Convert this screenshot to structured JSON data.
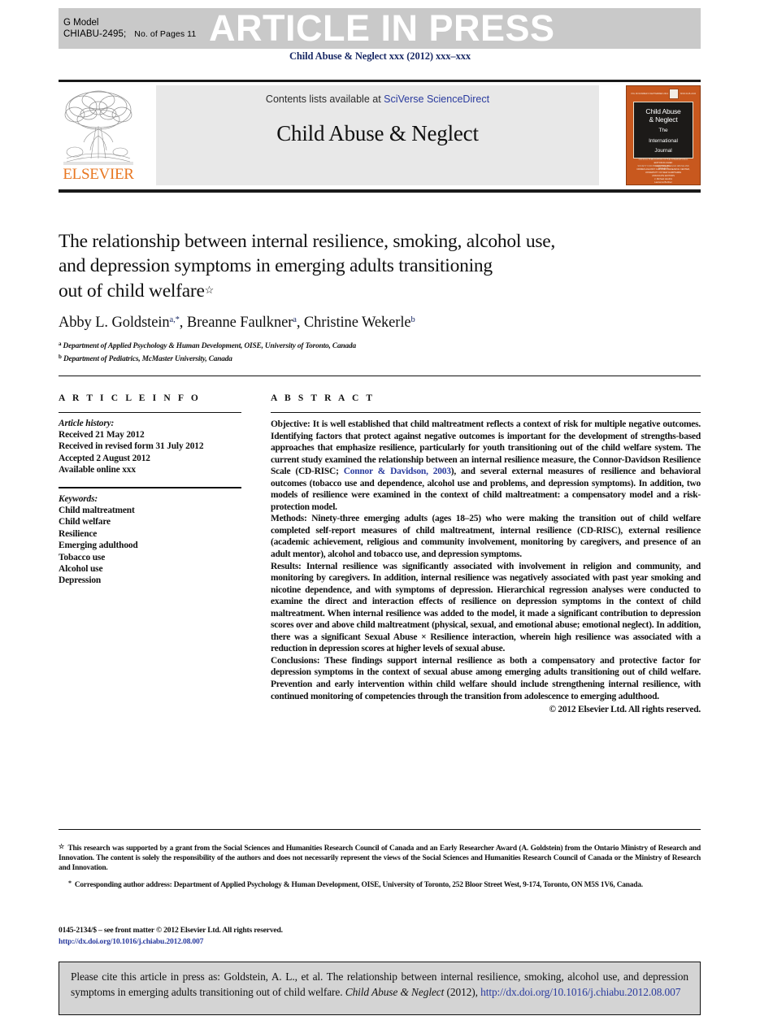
{
  "banner": {
    "gmodel_label": "G Model",
    "article_id": "CHIABU-2495;",
    "pages_label": "No. of Pages 11",
    "press_text": "ARTICLE IN PRESS",
    "banner_bg": "#c9c9c9",
    "press_color": "#ffffff"
  },
  "journal_citation": "Child Abuse & Neglect xxx (2012) xxx–xxx",
  "masthead": {
    "publisher_name": "ELSEVIER",
    "publisher_color": "#e87722",
    "contents_prefix": "Contents lists available at ",
    "contents_link": "SciVerse ScienceDirect",
    "link_color": "#2a3b9e",
    "journal_name": "Child Abuse & Neglect",
    "cover": {
      "top_left": "VOL 36 NUMBER 9 SEPTEMBER 2012",
      "top_right": "ISSN 0145-2134",
      "title_line1": "Child Abuse",
      "title_line2": "& Neglect",
      "subtitle_line1": "The",
      "subtitle_line2": "International",
      "subtitle_line3": "Journal",
      "tiny_line1": "OFFICIAL PUBLICATION OF THE INTERNATIONAL",
      "tiny_line2": "SOCIETY FOR PREVENTION OF CHILD ABUSE AND NEGLECT",
      "footer_line1": "EDITOR-IN-CHIEF",
      "footer_line2": "David Finkelhor",
      "footer_line3": "CRIMES AGAINST CHILDREN RESEARCH CENTER, UNIVERSITY OF NEW HAMPSHIRE",
      "footer_line4": "ASSOCIATE EDITORS",
      "footer_line5": "J. Michael Hendrix",
      "footer_line6": "Lawrence Berliner",
      "bg_color": "#c8581e"
    }
  },
  "article": {
    "title_line1": "The relationship between internal resilience, smoking, alcohol use,",
    "title_line2": "and depression symptoms in emerging adults transitioning",
    "title_line3": "out of child welfare",
    "title_footnote_mark": "☆",
    "authors": [
      {
        "name": "Abby L. Goldstein",
        "marks": "a,*"
      },
      {
        "name": "Breanne Faulkner",
        "marks": "a"
      },
      {
        "name": "Christine Wekerle",
        "marks": "b"
      }
    ],
    "affiliations": [
      {
        "mark": "a",
        "text": "Department of Applied Psychology & Human Development, OISE, University of Toronto, Canada"
      },
      {
        "mark": "b",
        "text": "Department of Pediatrics, McMaster University, Canada"
      }
    ]
  },
  "article_info": {
    "heading": "A R T I C L E   I N F O",
    "history_label": "Article history:",
    "history": [
      "Received 21 May 2012",
      "Received in revised form 31 July 2012",
      "Accepted 2 August 2012",
      "Available online xxx"
    ],
    "keywords_label": "Keywords:",
    "keywords": [
      "Child maltreatment",
      "Child welfare",
      "Resilience",
      "Emerging adulthood",
      "Tobacco use",
      "Alcohol use",
      "Depression"
    ]
  },
  "abstract": {
    "heading": "A B S T R A C T",
    "objective_label": "Objective:",
    "objective_part1": " It is well established that child maltreatment reflects a context of risk for multiple negative outcomes. Identifying factors that protect against negative outcomes is important for the development of strengths-based approaches that emphasize resilience, particularly for youth transitioning out of the child welfare system. The current study examined the relationship between an internal resilience measure, the Connor-Davidson Resilience Scale (CD-RISC; ",
    "objective_citation": "Connor & Davidson, 2003",
    "objective_part2": "), and several external measures of resilience and behavioral outcomes (tobacco use and dependence, alcohol use and problems, and depression symptoms). In addition, two models of resilience were examined in the context of child maltreatment: a compensatory model and a risk-protection model.",
    "methods_label": "Methods:",
    "methods_text": " Ninety-three emerging adults (ages 18–25) who were making the transition out of child welfare completed self-report measures of child maltreatment, internal resilience (CD-RISC), external resilience (academic achievement, religious and community involvement, monitoring by caregivers, and presence of an adult mentor), alcohol and tobacco use, and depression symptoms.",
    "results_label": "Results:",
    "results_text": " Internal resilience was significantly associated with involvement in religion and community, and monitoring by caregivers. In addition, internal resilience was negatively associated with past year smoking and nicotine dependence, and with symptoms of depression. Hierarchical regression analyses were conducted to examine the direct and interaction effects of resilience on depression symptoms in the context of child maltreatment. When internal resilience was added to the model, it made a significant contribution to depression scores over and above child maltreatment (physical, sexual, and emotional abuse; emotional neglect). In addition, there was a significant Sexual Abuse × Resilience interaction, wherein high resilience was associated with a reduction in depression scores at higher levels of sexual abuse.",
    "conclusions_label": "Conclusions:",
    "conclusions_text": " These findings support internal resilience as both a compensatory and protective factor for depression symptoms in the context of sexual abuse among emerging adults transitioning out of child welfare. Prevention and early intervention within child welfare should include strengthening internal resilience, with continued monitoring of competencies through the transition from adolescence to emerging adulthood.",
    "copyright": "© 2012 Elsevier Ltd. All rights reserved."
  },
  "footnotes": {
    "funding_mark": "☆",
    "funding_text": "This research was supported by a grant from the Social Sciences and Humanities Research Council of Canada and an Early Researcher Award (A. Goldstein) from the Ontario Ministry of Research and Innovation. The content is solely the responsibility of the authors and does not necessarily represent the views of the Social Sciences and Humanities Research Council of Canada or the Ministry of Research and Innovation.",
    "corresponding_mark": "*",
    "corresponding_text": "Corresponding author address: Department of Applied Psychology & Human Development, OISE, University of Toronto, 252 Bloor Street West, 9-174, Toronto, ON M5S 1V6, Canada."
  },
  "issn": {
    "line": "0145-2134/$ – see front matter © 2012 Elsevier Ltd. All rights reserved.",
    "doi": "http://dx.doi.org/10.1016/j.chiabu.2012.08.007"
  },
  "cite_box": {
    "text_part1": "Please cite this article in press as: Goldstein, A. L., et al. The relationship between internal resilience, smoking, alcohol use, and depression symptoms in emerging adults transitioning out of child welfare. ",
    "journal_italic": "Child Abuse & Neglect",
    "text_part2": " (2012),",
    "doi": "http://dx.doi.org/10.1016/j.chiabu.2012.08.007"
  }
}
